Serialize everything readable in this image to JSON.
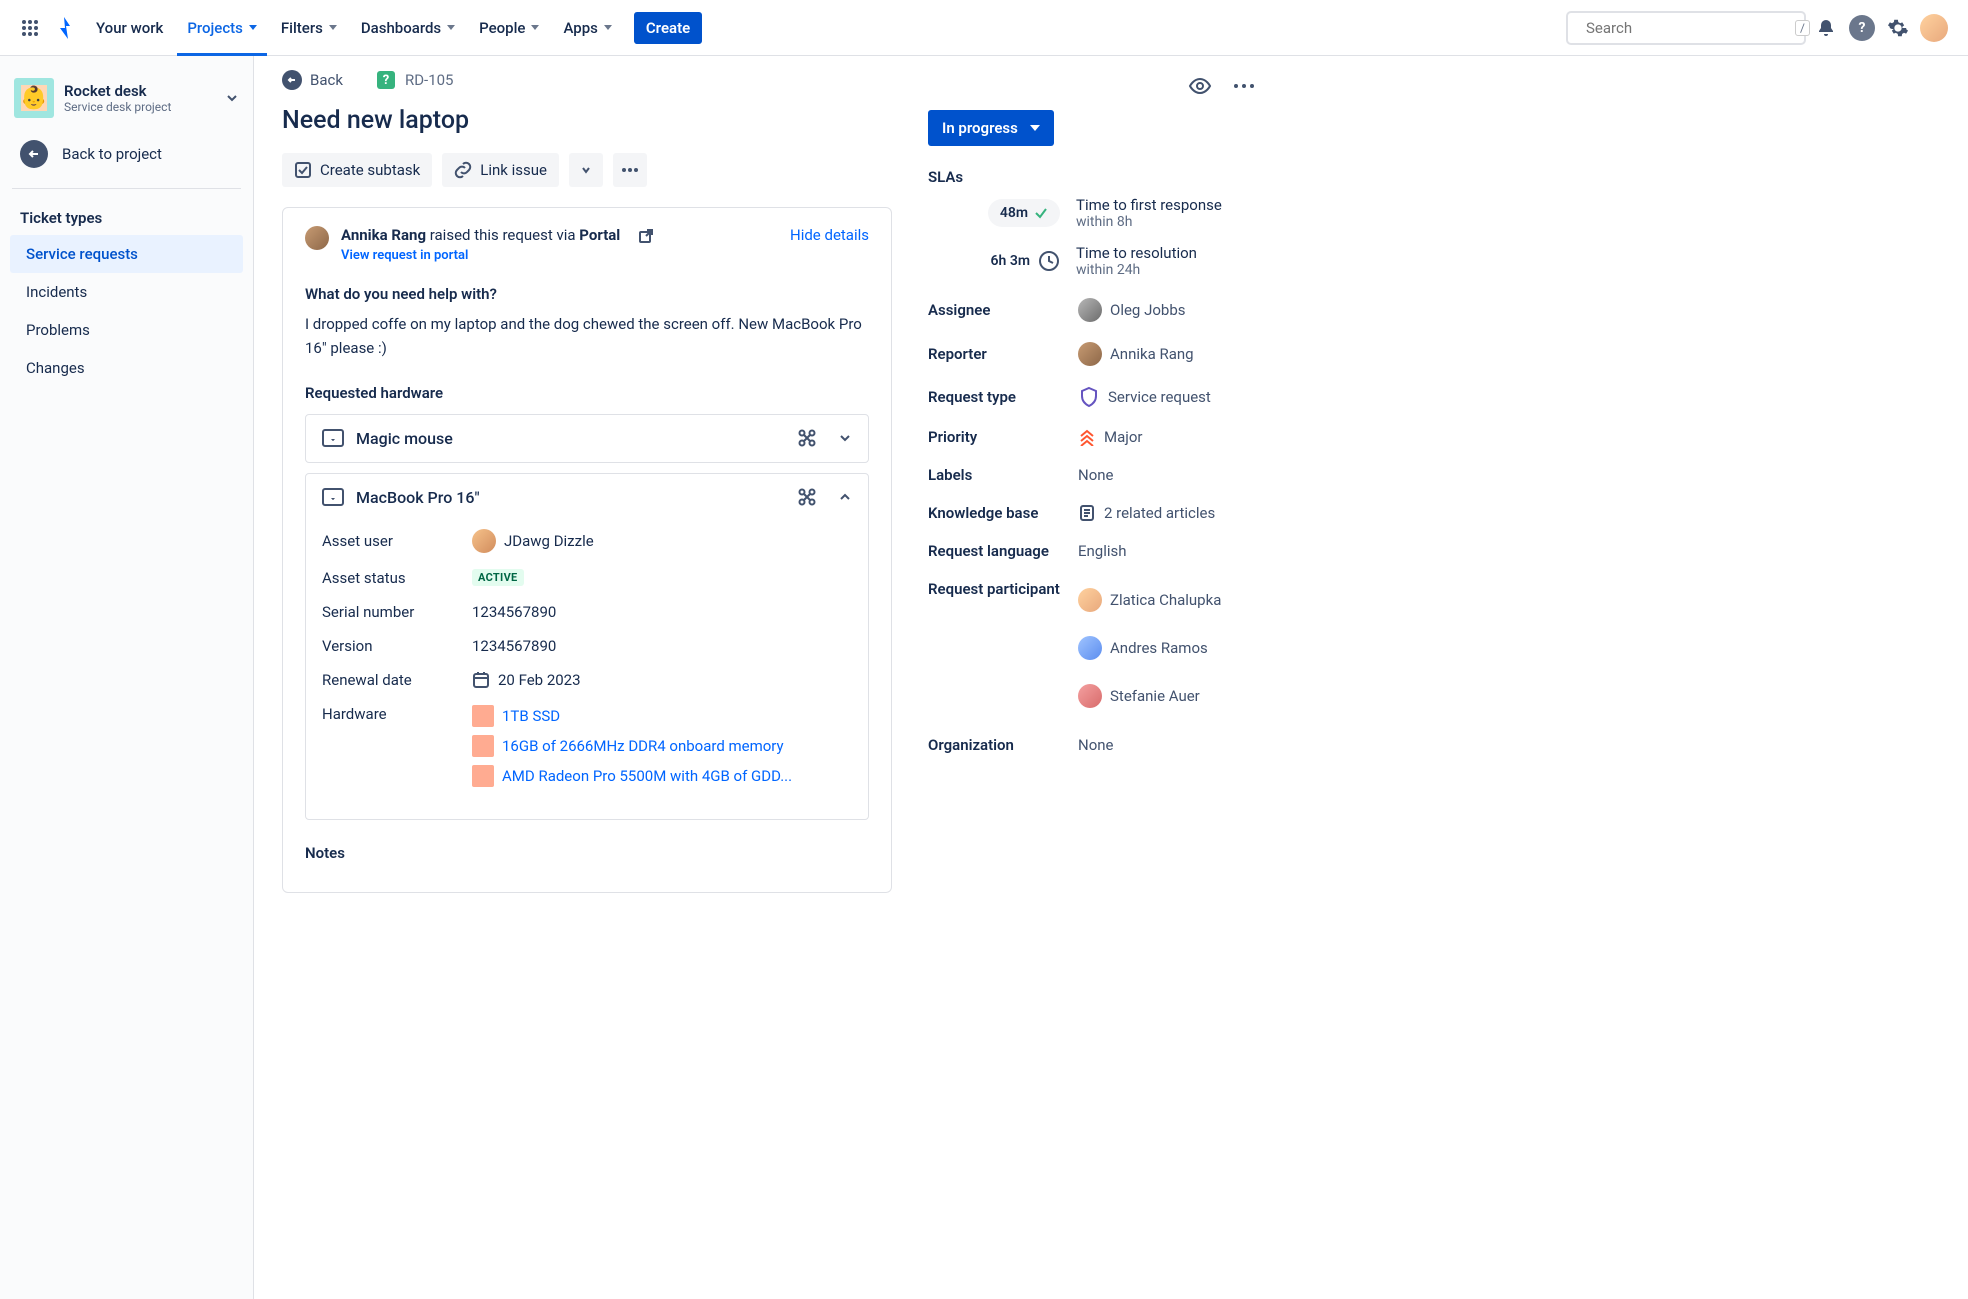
{
  "nav": {
    "your_work": "Your work",
    "projects": "Projects",
    "filters": "Filters",
    "dashboards": "Dashboards",
    "people": "People",
    "apps": "Apps",
    "create": "Create",
    "search_placeholder": "Search",
    "kbd": "/"
  },
  "sidebar": {
    "project_name": "Rocket desk",
    "project_type": "Service desk project",
    "back_to_project": "Back to project",
    "ticket_types_heading": "Ticket types",
    "items": {
      "service_requests": "Service requests",
      "incidents": "Incidents",
      "problems": "Problems",
      "changes": "Changes"
    }
  },
  "crumb": {
    "back": "Back",
    "issue_key": "RD-105"
  },
  "issue": {
    "title": "Need new laptop",
    "create_subtask": "Create subtask",
    "link_issue": "Link issue",
    "reporter_name": "Annika Rang",
    "raised_via_pre": " raised this request via ",
    "raised_via_source": "Portal",
    "hide_details": "Hide details",
    "view_in_portal": "View request in portal",
    "question": "What do you need help with?",
    "description": "I dropped coffe on my laptop and the dog chewed the screen off. New MacBook Pro 16\" please :)",
    "requested_hw_heading": "Requested hardware",
    "notes_heading": "Notes"
  },
  "hardware": {
    "item1_name": "Magic mouse",
    "item2_name": "MacBook Pro 16\"",
    "asset_user_label": "Asset user",
    "asset_user_value": "JDawg Dizzle",
    "asset_status_label": "Asset status",
    "asset_status_value": "ACTIVE",
    "serial_label": "Serial number",
    "serial_value": "1234567890",
    "version_label": "Version",
    "version_value": "1234567890",
    "renewal_label": "Renewal date",
    "renewal_value": "20 Feb 2023",
    "hw_label": "Hardware",
    "hw1": "1TB SSD",
    "hw2": "16GB of 2666MHz DDR4 onboard memory",
    "hw3": "AMD Radeon Pro 5500M with 4GB of GDD..."
  },
  "details": {
    "status": "In progress",
    "slas_heading": "SLAs",
    "sla1_time": "48m",
    "sla1_label": "Time to first response",
    "sla1_within": "within 8h",
    "sla2_time": "6h 3m",
    "sla2_label": "Time to resolution",
    "sla2_within": "within 24h",
    "assignee_label": "Assignee",
    "assignee_value": "Oleg Jobbs",
    "reporter_label": "Reporter",
    "reporter_value": "Annika Rang",
    "request_type_label": "Request type",
    "request_type_value": "Service request",
    "priority_label": "Priority",
    "priority_value": "Major",
    "labels_label": "Labels",
    "labels_value": "None",
    "kb_label": "Knowledge base",
    "kb_value": "2 related articles",
    "lang_label": "Request language",
    "lang_value": "English",
    "participant_label": "Request participant",
    "p1": "Zlatica Chalupka",
    "p2": "Andres Ramos",
    "p3": "Stefanie Auer",
    "org_label": "Organization",
    "org_value": "None"
  }
}
